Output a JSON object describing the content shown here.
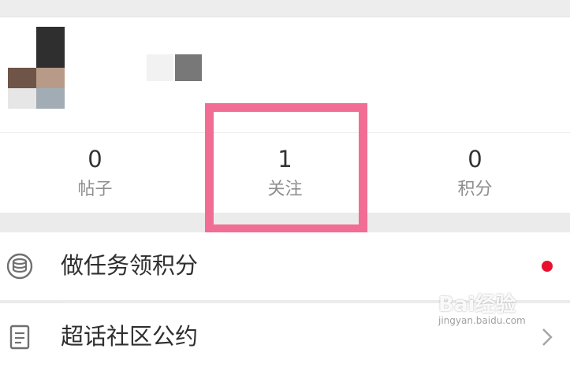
{
  "stats": [
    {
      "value": "0",
      "label": "帖子"
    },
    {
      "value": "1",
      "label": "关注"
    },
    {
      "value": "0",
      "label": "积分"
    }
  ],
  "menu": [
    {
      "title": "做任务领积分",
      "icon": "coins-icon",
      "badge": "red-dot"
    },
    {
      "title": "超话社区公约",
      "icon": "document-list-icon",
      "trailing": "chevron-right-icon"
    }
  ],
  "watermark": {
    "brand": "Bai经验",
    "url": "jingyan.baidu.com"
  },
  "colors": {
    "highlight": "#f26d94",
    "badge": "#e8112d",
    "background": "#ebebeb"
  }
}
